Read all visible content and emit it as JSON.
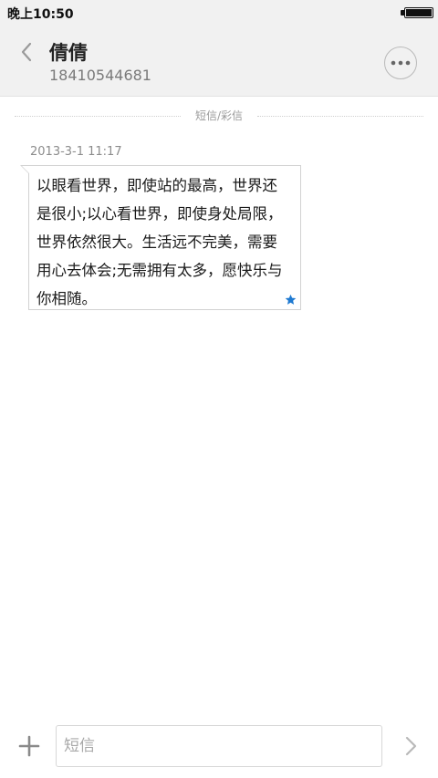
{
  "status_bar": {
    "time": "晚上10:50"
  },
  "header": {
    "contact_name": "倩倩",
    "contact_number": "18410544681",
    "back_icon": "chevron-left-icon",
    "more_icon": "more-horizontal-icon"
  },
  "conversation": {
    "channel_label": "短信/彩信",
    "messages": [
      {
        "timestamp": "2013-3-1 11:17",
        "text": "以眼看世界，即使站的最高，世界还是很小;以心看世界，即使身处局限，世界依然很大。生活远不完美，需要用心去体会;无需拥有太多，愿快乐与你相随。",
        "starred": true
      }
    ]
  },
  "composer": {
    "placeholder": "短信",
    "value": "",
    "add_icon": "plus-icon",
    "send_icon": "chevron-right-icon"
  },
  "colors": {
    "header_bg": "#f1f1f1",
    "star": "#1f7ad1",
    "icon_gray": "#9a9a9a"
  }
}
